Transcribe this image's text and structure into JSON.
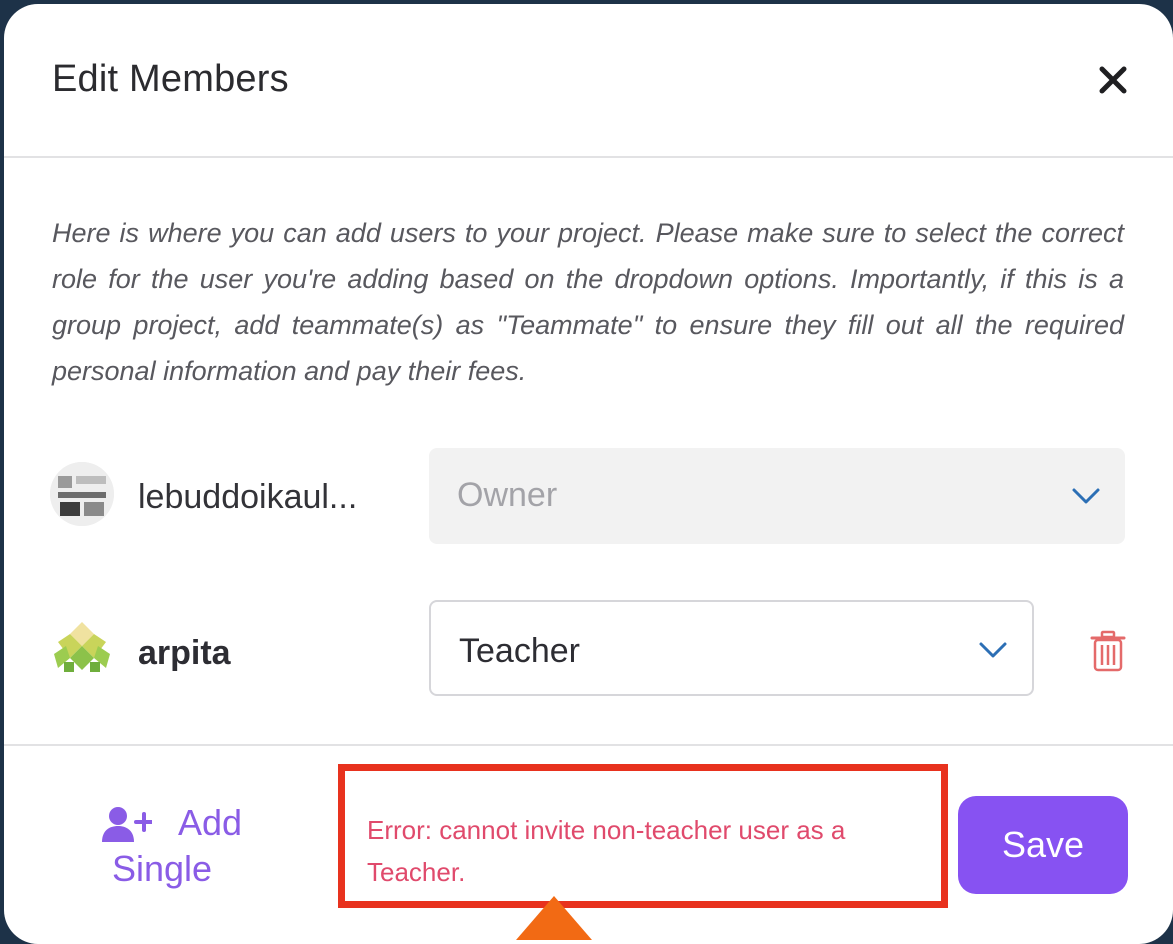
{
  "modal": {
    "title": "Edit Members",
    "close_icon": "close-icon",
    "description": "Here is where you can add users to your project. Please make sure to select the correct role for the user you're adding based on the dropdown options. Importantly, if this is a group project, add teammate(s) as \"Teammate\" to ensure they fill out all the required personal information and pay their fees."
  },
  "members": [
    {
      "name": "lebuddoikaul...",
      "role": "Owner",
      "role_disabled": true,
      "avatar_icon": "user-avatar-icon"
    },
    {
      "name": "arpita",
      "role": "Teacher",
      "role_disabled": false,
      "avatar_icon": "identicon-avatar-icon",
      "delete_icon": "trash-icon"
    }
  ],
  "footer": {
    "add_single_line1": "Add",
    "add_single_line2": "Single",
    "add_icon": "add-user-icon",
    "error_message": "Error: cannot invite non-teacher user as a Teacher.",
    "save_label": "Save"
  },
  "colors": {
    "accent": "#8752f2",
    "error_text": "#e04a6c",
    "highlight_box": "#e8321e",
    "pointer_arrow": "#f26a14",
    "trash": "#e46a6a",
    "chevron": "#2c6fb5"
  }
}
